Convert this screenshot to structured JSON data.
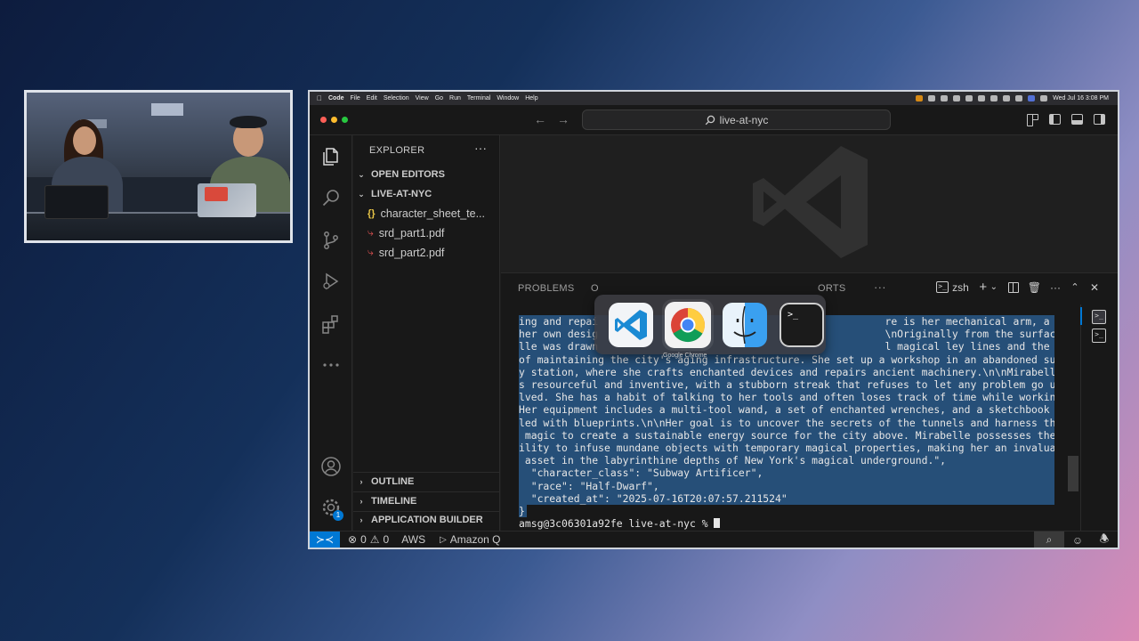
{
  "menubar": {
    "app_name": "Code",
    "items": [
      "File",
      "Edit",
      "Selection",
      "View",
      "Go",
      "Run",
      "Terminal",
      "Window",
      "Help"
    ],
    "clock": "Wed Jul 16  3:08 PM"
  },
  "titlebar": {
    "search_text": "live-at-nyc"
  },
  "explorer": {
    "title": "EXPLORER",
    "more": "···",
    "open_editors": "OPEN EDITORS",
    "folder": "LIVE-AT-NYC",
    "files": [
      {
        "name": "character_sheet_te...",
        "icon": "json-braces-icon"
      },
      {
        "name": "srd_part1.pdf",
        "icon": "pdf-icon"
      },
      {
        "name": "srd_part2.pdf",
        "icon": "pdf-icon"
      }
    ],
    "outline": "OUTLINE",
    "timeline": "TIMELINE",
    "app_builder": "APPLICATION BUILDER"
  },
  "activity": {
    "settings_badge": "1"
  },
  "panel": {
    "tab_problems": "PROBLEMS",
    "tab_output_partial": "O",
    "tab_ports_partial": "ORTS",
    "tab_more": "···",
    "shell_name": "zsh"
  },
  "switcher": {
    "apps": [
      "Visual Studio Code",
      "Google Chrome",
      "Finder",
      "Terminal"
    ],
    "selected_label": "Google Chrome"
  },
  "terminal": {
    "lines": [
      "ing and repai                                               re is her mechanical arm, a marvel of",
      "her own desig                                               \\nOriginally from the surface, Mirabe",
      "lle was drawn                                               l magical ley lines and the challenge",
      "of maintaining the city's aging infrastructure. She set up a workshop in an abandoned subwa",
      "y station, where she crafts enchanted devices and repairs ancient machinery.\\n\\nMirabelle i",
      "s resourceful and inventive, with a stubborn streak that refuses to let any problem go unso",
      "lved. She has a habit of talking to her tools and often loses track of time while working.",
      "Her equipment includes a multi-tool wand, a set of enchanted wrenches, and a sketchbook fil",
      "led with blueprints.\\n\\nHer goal is to uncover the secrets of the tunnels and harness their",
      " magic to create a sustainable energy source for the city above. Mirabelle possesses the ab",
      "ility to infuse mundane objects with temporary magical properties, making her an invaluable",
      " asset in the labyrinthine depths of New York's magical underground.\",",
      "  \"character_class\": \"Subway Artificer\",",
      "  \"race\": \"Half-Dwarf\",",
      "  \"created_at\": \"2025-07-16T20:07:57.211524\""
    ],
    "closing_brace": "}",
    "prompt": "amsg@3c06301a92fe live-at-nyc % "
  },
  "statusbar": {
    "errors": "0",
    "warnings": "0",
    "aws": "AWS",
    "amazon_q": "Amazon Q"
  },
  "colors": {
    "accent": "#0078d4",
    "selection": "#264f78"
  }
}
